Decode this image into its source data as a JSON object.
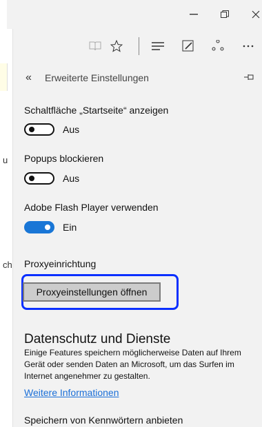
{
  "window": {
    "minimize_icon": "minimize-icon",
    "restore_icon": "restore-icon",
    "close_icon": "close-icon"
  },
  "toolbar": {
    "icons": [
      "reading-view-icon",
      "favorites-star-icon",
      "hub-icon",
      "web-note-icon",
      "share-icon",
      "more-icon"
    ]
  },
  "page_behind": {
    "char1": "u",
    "char2": "ch"
  },
  "panel": {
    "back_glyph": "«",
    "title": "Erweiterte Einstellungen",
    "settings": [
      {
        "label": "Schaltfläche „Startseite“ anzeigen",
        "state": "Aus",
        "on": false
      },
      {
        "label": "Popups blockieren",
        "state": "Aus",
        "on": false
      },
      {
        "label": "Adobe Flash Player verwenden",
        "state": "Ein",
        "on": true
      }
    ],
    "proxy": {
      "heading": "Proxyeinrichtung",
      "button": "Proxyeinstellungen öffnen"
    },
    "privacy": {
      "title": "Datenschutz und Dienste",
      "description": "Einige Features speichern möglicherweise Daten auf Ihrem Gerät oder senden Daten an Microsoft, um das Surfen im Internet angenehmer zu gestalten.",
      "link": "Weitere Informationen"
    },
    "next_item": "Speichern von Kennwörtern anbieten"
  }
}
